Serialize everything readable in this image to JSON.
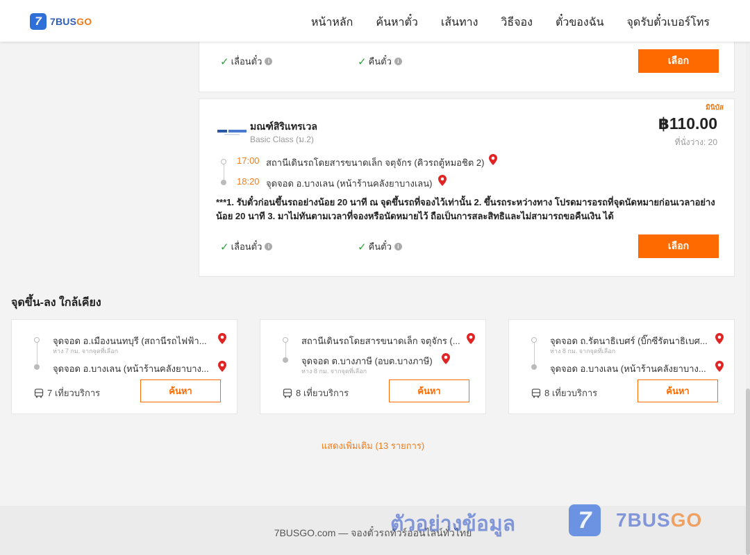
{
  "header": {
    "logo_mark": "7",
    "logo_text_a": "7BUS",
    "logo_text_b": "GO",
    "nav": [
      "หน้าหลัก",
      "ค้นหาตั๋ว",
      "เส้นทาง",
      "วิธีจอง",
      "ตั๋วของฉัน",
      "จุดรับตั๋วเบอร์โทร"
    ]
  },
  "top_card": {
    "feature_change": "เลื่อนตั๋ว",
    "feature_refund": "คืนตั๋ว",
    "select_label": "เลือก"
  },
  "main_card": {
    "badge": "มินิบัส",
    "operator_name": "มณฑ์สิริแทรเวล",
    "class": "Basic Class (ม.2)",
    "price": "฿110.00",
    "seats": "ที่นั่งว่าง: 20",
    "stops": [
      {
        "time": "17:00",
        "name": "สถานีเดินรถโดยสารขนาดเล็ก จตุจักร (คิวรถตู้หมอชิต 2)"
      },
      {
        "time": "18:20",
        "name": "จุดจอด อ.บางเลน (หน้าร้านคลังยาบางเลน)"
      }
    ],
    "notice": "***1. รับตั๋วก่อนขึ้นรถอย่างน้อย 20 นาที ณ จุดขึ้นรถที่จองไว้เท่านั้น 2. ขึ้นรถระหว่างทาง โปรดมารอรถที่จุดนัดหมายก่อนเวลาอย่างน้อย 20 นาที 3. มาไม่ทันตามเวลาที่จองหรือนัดหมายไว้ ถือเป็นการสละสิทธิและไม่สามารถขอคืนเงิน ได้",
    "feature_change": "เลื่อนตั๋ว",
    "feature_refund": "คืนตั๋ว",
    "select_label": "เลือก"
  },
  "nearby": {
    "title": "จุดขึ้น-ลง ใกล้เคียง",
    "cards": [
      {
        "from": "จุดจอด อ.เมืองนนทบุรี (สถานีรถไฟฟ้า...",
        "from_sub": "ห่าง 7 กม. จากจุดที่เลือก",
        "to": "จุดจอด อ.บางเลน (หน้าร้านคลังยาบาง...",
        "to_sub": "",
        "trips": "7 เที่ยวบริการ",
        "search_label": "ค้นหา"
      },
      {
        "from": "สถานีเดินรถโดยสารขนาดเล็ก จตุจักร (...",
        "from_sub": "",
        "to": "จุดจอด ต.บางภาษี (อบต.บางภาษี)",
        "to_sub": "ห่าง 8 กม. จากจุดที่เลือก",
        "trips": "8 เที่ยวบริการ",
        "search_label": "ค้นหา"
      },
      {
        "from": "จุดจอด ถ.รัตนาธิเบศร์ (บิ๊กซีรัตนาธิเบศ...",
        "from_sub": "ห่าง 8 กม. จากจุดที่เลือก",
        "to": "จุดจอด อ.บางเลน (หน้าร้านคลังยาบาง...",
        "to_sub": "",
        "trips": "8 เที่ยวบริการ",
        "search_label": "ค้นหา"
      }
    ],
    "show_more": "แสดงเพิ่มเติม (13 รายการ)"
  },
  "footer": {
    "text": "7BUSGO.com — จองตั๋วรถทัวร์ออนไลน์ทั่วไทย"
  },
  "watermark": {
    "thai": "ตัวอย่างข้อมูล",
    "mark": "7",
    "text_a": "7BUS",
    "text_b": "GO"
  },
  "colors": {
    "accent": "#ff6a00",
    "time": "#ee7d1c",
    "check": "#2f9d3a",
    "pin": "#e02424",
    "logo_blue": "#2f6fd8"
  }
}
